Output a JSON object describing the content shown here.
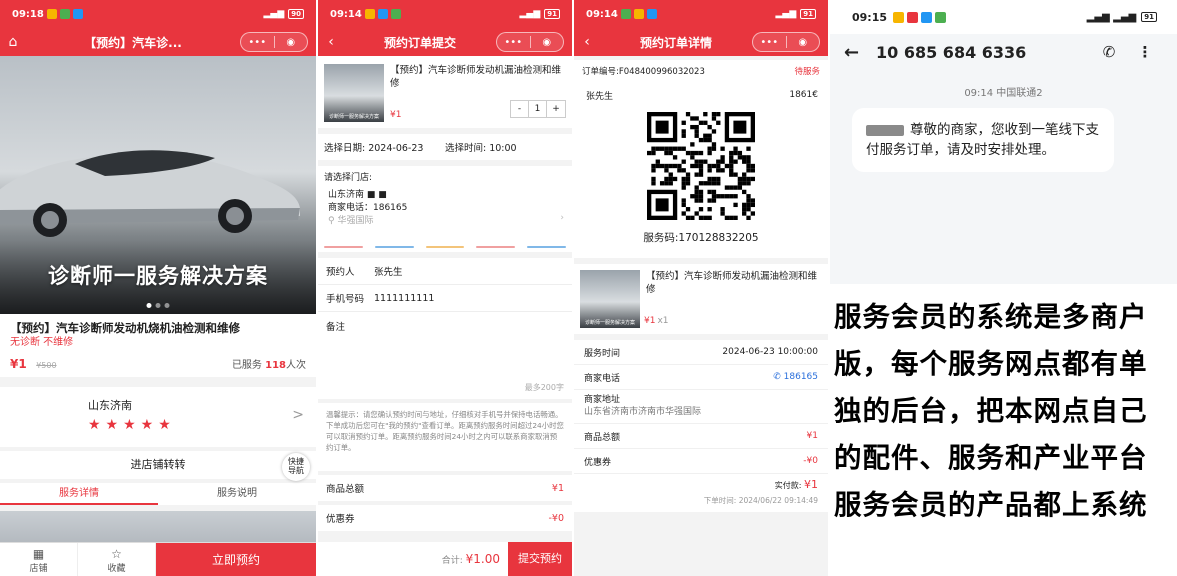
{
  "panel1": {
    "status_time": "09:18",
    "battery": "90",
    "nav_title": "【预约】汽车诊...",
    "hero_text": "诊断师一服务解决方案",
    "product_name": "【预约】汽车诊断师发动机烧机油检测和维修",
    "product_sub": "无诊断  不维修",
    "price": "¥1",
    "old_price": "¥500",
    "served_prefix": "已服务 ",
    "served_count": "118",
    "served_suffix": "人次",
    "store_name": "山东济南",
    "stars": "★★★★★",
    "enter_store": "进店铺转转",
    "quick_nav": "快捷\n导航",
    "tabs": [
      "服务详情",
      "服务说明"
    ],
    "bottom": {
      "store": "店铺",
      "fav": "收藏",
      "book": "立即预约"
    }
  },
  "panel2": {
    "status_time": "09:14",
    "battery": "91",
    "nav_title": "预约订单提交",
    "product_name": "【预约】汽车诊断师发动机漏油检测和维修",
    "price": "¥1",
    "thumb_caption": "诊断师一服务解决方案",
    "qty": "1",
    "date_label": "选择日期: 2024-06-23",
    "time_label": "选择时间: 10:00",
    "store_prompt": "请选择门店:",
    "store_name": "山东济南 ■ ■",
    "store_phone": "商家电话：186165",
    "store_area": "华强国际",
    "form": [
      {
        "key": "预约人",
        "value": "张先生"
      },
      {
        "key": "手机号码",
        "value": "1111111111"
      },
      {
        "key": "备注",
        "value": ""
      }
    ],
    "note_count": "最多200字",
    "tips": "温馨提示：请您确认预约时间与地址，仔细核对手机号并保持电话畅通。下单成功后您可在\"我的预约\"查看订单。距离预约服务时间超过24小时您可以取消预约订单。距离预约服务时间24小时之内可以联系商家取消预约订单。",
    "goods_total_label": "商品总额",
    "goods_total": "¥1",
    "coupon_label": "优惠券",
    "coupon": "-¥0",
    "total_label": "合计:",
    "total": "¥1.00",
    "submit": "提交预约"
  },
  "panel3": {
    "status_time": "09:14",
    "battery": "91",
    "nav_title": "预约订单详情",
    "order_no": "订单编号:F048400996032023",
    "order_status": "待服务",
    "customer": "张先生",
    "phone": "1861€",
    "service_code": "服务码:170128832205",
    "product_name": "【预约】汽车诊断师发动机漏油检测和维修",
    "price": "¥1",
    "qty": "x1",
    "thumb_caption": "诊断师一服务解决方案",
    "rows": [
      {
        "k": "服务时间",
        "v": "2024-06-23 10:00:00"
      },
      {
        "k": "商家电话",
        "v": "✆ 186165"
      }
    ],
    "addr_label": "商家地址",
    "addr_value": "山东省济南市济南市华强国际",
    "goods_total_label": "商品总额",
    "goods_total": "¥1",
    "coupon_label": "优惠券",
    "coupon": "-¥0",
    "paid_label": "实付款:",
    "paid": "¥1",
    "order_time": "下单时间: 2024/06/22 09:14:49"
  },
  "panel4": {
    "status_time": "09:15",
    "battery": "91",
    "sender": "10 685 684 6336",
    "meta": "09:14 中国联通2",
    "message": "尊敬的商家，您收到一笔线下支付服务订单，请及时安排处理。",
    "caption": "服务会员的系统是多商户版，每个服务网点都有单独的后台，把本网点自己的配件、服务和产业平台服务会员的产品都上系统"
  },
  "colors": {
    "brand_red": "#e8353e",
    "link_blue": "#2a6fdb"
  },
  "icons": [
    "home-icon",
    "back-arrow-icon",
    "more-dots-icon",
    "target-icon",
    "store-icon",
    "star-icon",
    "phone-icon",
    "menu-dots-icon"
  ]
}
